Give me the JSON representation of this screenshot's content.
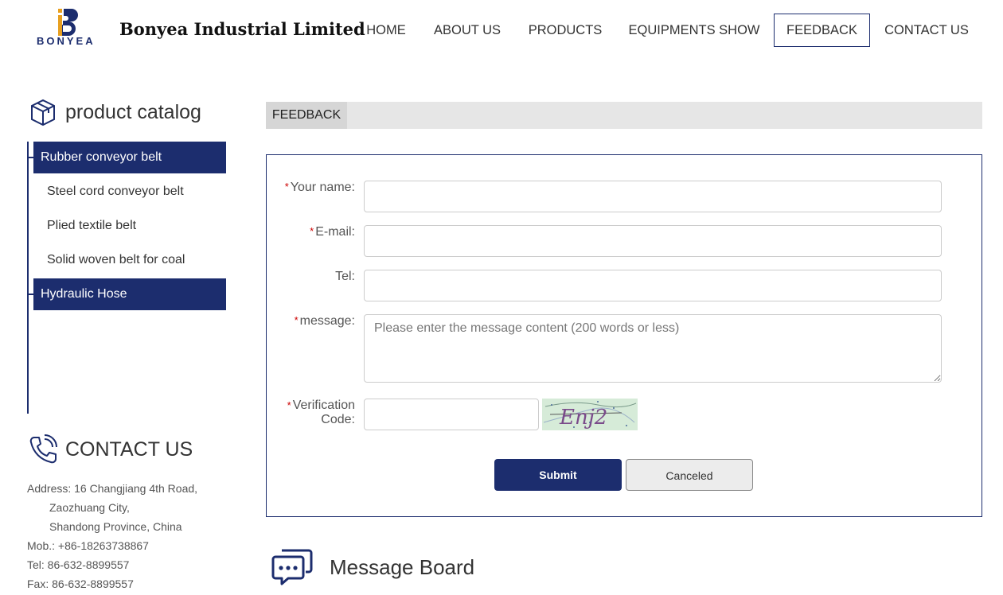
{
  "brand": {
    "logo_text": "BONYEA",
    "company_name": "Bonyea Industrial Limited",
    "accent_color": "#1c2d6e",
    "logo_gold": "#e8a020"
  },
  "nav": {
    "items": [
      {
        "label": "HOME"
      },
      {
        "label": "ABOUT US"
      },
      {
        "label": "PRODUCTS"
      },
      {
        "label": "EQUIPMENTS SHOW"
      },
      {
        "label": "FEEDBACK",
        "active": true
      },
      {
        "label": "CONTACT US"
      }
    ]
  },
  "sidebar": {
    "catalog_title": "product catalog",
    "catalog_icon": "box-icon",
    "items": [
      {
        "label": "Rubber conveyor belt",
        "level": "main"
      },
      {
        "label": "Steel cord conveyor belt",
        "level": "sub"
      },
      {
        "label": "Plied textile belt",
        "level": "sub"
      },
      {
        "label": "Solid woven belt for coal",
        "level": "sub"
      },
      {
        "label": "Hydraulic Hose",
        "level": "main"
      }
    ],
    "contact_title": "CONTACT US",
    "contact_icon": "phone-icon",
    "contact_lines": [
      "Address: 16 Changjiang 4th Road,",
      "Zaozhuang City,",
      "Shandong Province, China",
      "Mob.: +86-18263738867",
      "Tel: 86-632-8899557",
      "Fax: 86-632-8899557"
    ]
  },
  "feedback": {
    "tab_label": "FEEDBACK",
    "required_mark": "*",
    "name_label": "Your name:",
    "email_label": "E-mail:",
    "tel_label": "Tel:",
    "message_label": "message:",
    "message_placeholder": "Please enter the message content (200 words or less)",
    "verification_label_1": "Verification",
    "verification_label_2": "Code:",
    "captcha_text": "Enj2",
    "submit_label": "Submit",
    "cancel_label": "Canceled"
  },
  "message_board": {
    "title": "Message Board",
    "icon": "chat-bubbles-icon"
  }
}
